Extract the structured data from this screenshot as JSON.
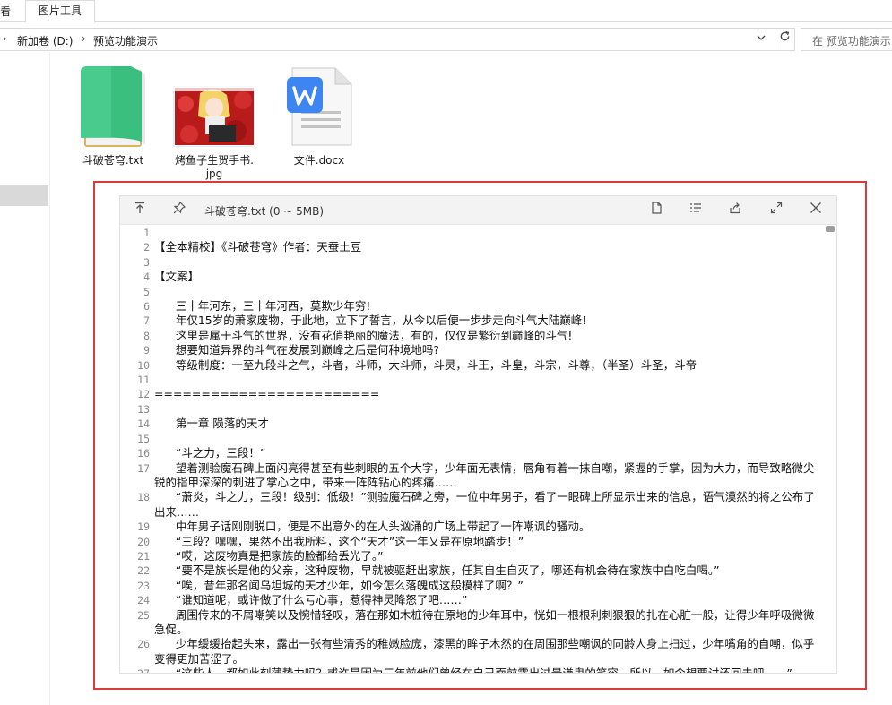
{
  "ribbon": {
    "tab_view": "看",
    "tab_picture_tools": "图片工具"
  },
  "address": {
    "crumbs": [
      "新加卷 (D:)",
      "预览功能演示"
    ],
    "search_placeholder": "在 预览功能演示"
  },
  "files": [
    {
      "name": "斗破苍穹.txt",
      "icon": "notepad-icon"
    },
    {
      "name": "烤鱼子生贺手书.jpg",
      "name_line1": "烤鱼子生贺手书.",
      "name_line2": "jpg",
      "icon": "image-thumbnail"
    },
    {
      "name": "文件.docx",
      "icon": "wps-doc-icon"
    }
  ],
  "preview": {
    "title": "斗破苍穹.txt (0 ~ 5MB)",
    "lines": [
      {
        "n": "1",
        "t": ""
      },
      {
        "n": "2",
        "t": "【全本精校】《斗破苍穹》作者：天蚕土豆"
      },
      {
        "n": "3",
        "t": ""
      },
      {
        "n": "4",
        "t": "【文案】"
      },
      {
        "n": "5",
        "t": ""
      },
      {
        "n": "6",
        "t": "      三十年河东，三十年河西，莫欺少年穷!"
      },
      {
        "n": "7",
        "t": "      年仅15岁的萧家废物，于此地，立下了誓言，从今以后便一步步走向斗气大陆巅峰!"
      },
      {
        "n": "8",
        "t": "      这里是属于斗气的世界，没有花俏艳丽的魔法，有的，仅仅是繁衍到巅峰的斗气!"
      },
      {
        "n": "9",
        "t": "      想要知道异界的斗气在发展到巅峰之后是何种境地吗?"
      },
      {
        "n": "10",
        "t": "      等级制度：一至九段斗之气，斗者，斗师，大斗师，斗灵，斗王，斗皇，斗宗，斗尊，（半圣）斗圣，斗帝"
      },
      {
        "n": "11",
        "t": ""
      },
      {
        "n": "12",
        "t": "========================"
      },
      {
        "n": "13",
        "t": ""
      },
      {
        "n": "14",
        "t": "      第一章 陨落的天才"
      },
      {
        "n": "15",
        "t": ""
      },
      {
        "n": "16",
        "t": "      “斗之力，三段！”"
      },
      {
        "n": "17",
        "t": "      望着测验魔石碑上面闪亮得甚至有些刺眼的五个大字，少年面无表情，唇角有着一抹自嘲，紧握的手掌，因为大力，而导致略微尖锐的指甲深深的刺进了掌心之中，带来一阵阵钻心的疼痛……"
      },
      {
        "n": "18",
        "t": "      “萧炎，斗之力，三段！级别：低级！”测验魔石碑之旁，一位中年男子，看了一眼碑上所显示出来的信息，语气漠然的将之公布了出来……"
      },
      {
        "n": "19",
        "t": "      中年男子话刚刚脱口，便是不出意外的在人头汹涌的广场上带起了一阵嘲讽的骚动。"
      },
      {
        "n": "20",
        "t": "      “三段？嘿嘿，果然不出我所料，这个“天才”这一年又是在原地踏步！”"
      },
      {
        "n": "21",
        "t": "      “哎，这废物真是把家族的脸都给丢光了。”"
      },
      {
        "n": "22",
        "t": "      “要不是族长是他的父亲，这种废物，早就被驱赶出家族，任其自生自灭了，哪还有机会待在家族中白吃白喝。”"
      },
      {
        "n": "23",
        "t": "      “唉，昔年那名闻乌坦城的天才少年，如今怎么落魄成这般模样了啊？”"
      },
      {
        "n": "24",
        "t": "      “谁知道呢，或许做了什么亏心事，惹得神灵降怒了吧……”"
      },
      {
        "n": "25",
        "t": "      周围传来的不屑嘲笑以及惋惜轻叹，落在那如木桩待在原地的少年耳中，恍如一根根利刺狠狠的扎在心脏一般，让得少年呼吸微微急促。"
      },
      {
        "n": "26",
        "t": "      少年缓缓抬起头来，露出一张有些清秀的稚嫩脸庞，漆黑的眸子木然的在周围那些嘲讽的同龄人身上扫过，少年嘴角的自嘲，似乎变得更加苦涩了。"
      },
      {
        "n": "27",
        "t": "      “这些人，都如此刻薄势力吗？或许是因为三年前他们曾经在自己面前露出过最谦卑的笑容，所以，如今想要讨还回去吧……”"
      }
    ]
  }
}
